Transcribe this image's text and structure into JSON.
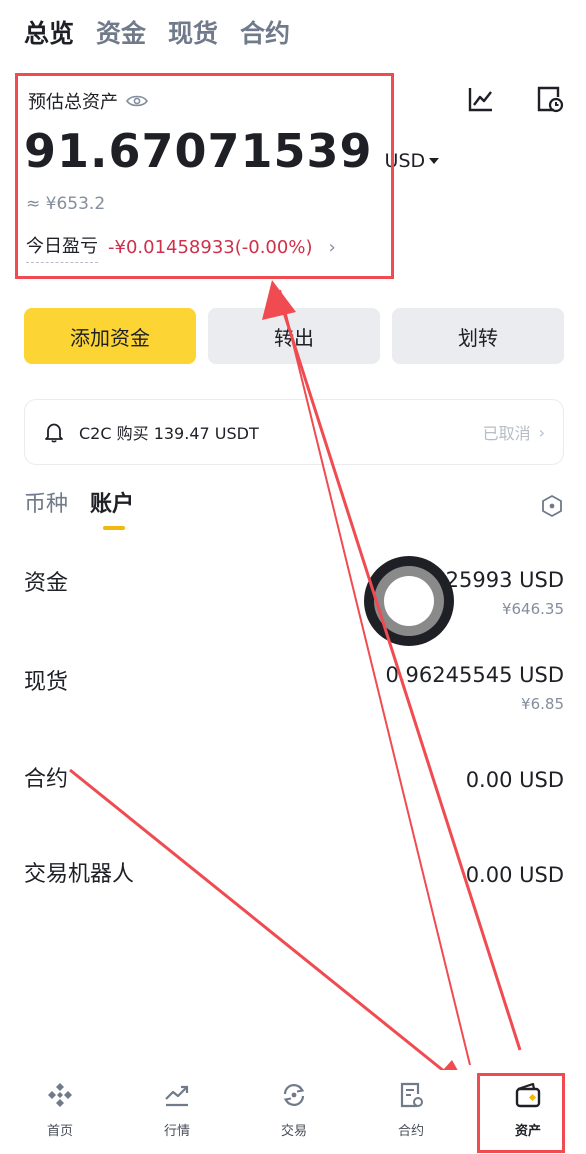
{
  "top_tabs": [
    "总览",
    "资金",
    "现货",
    "合约"
  ],
  "estimate": {
    "label": "预估总资产",
    "value": "91.67071539",
    "unit": "USD",
    "approx": "≈ ¥653.2",
    "pnl_label": "今日盈亏",
    "pnl_value": "-¥0.01458933(-0.00%)"
  },
  "actions": {
    "deposit": "添加资金",
    "withdraw": "转出",
    "transfer": "划转"
  },
  "notice": {
    "text": "C2C 购买 139.47 USDT",
    "status": "已取消"
  },
  "sub_tabs": [
    "币种",
    "账户"
  ],
  "accounts": [
    {
      "name": "资金",
      "usd": "90.70825993 USD",
      "cny": "¥646.35"
    },
    {
      "name": "现货",
      "usd": "0.96245545 USD",
      "cny": "¥6.85"
    },
    {
      "name": "合约",
      "usd": "0.00 USD",
      "cny": ""
    },
    {
      "name": "交易机器人",
      "usd": "0.00 USD",
      "cny": ""
    }
  ],
  "bottom_nav": [
    "首页",
    "行情",
    "交易",
    "合约",
    "资产"
  ],
  "colors": {
    "accent": "#fcd535",
    "negative": "#cf304a",
    "annotation": "#ef4b50",
    "tab_indicator": "#f0b90b"
  },
  "icons": [
    "line-chart-icon",
    "history-icon",
    "eye-icon",
    "bell-icon",
    "hexagon-settings-icon",
    "home-icon",
    "markets-icon",
    "trade-icon",
    "futures-icon",
    "wallet-icon"
  ]
}
